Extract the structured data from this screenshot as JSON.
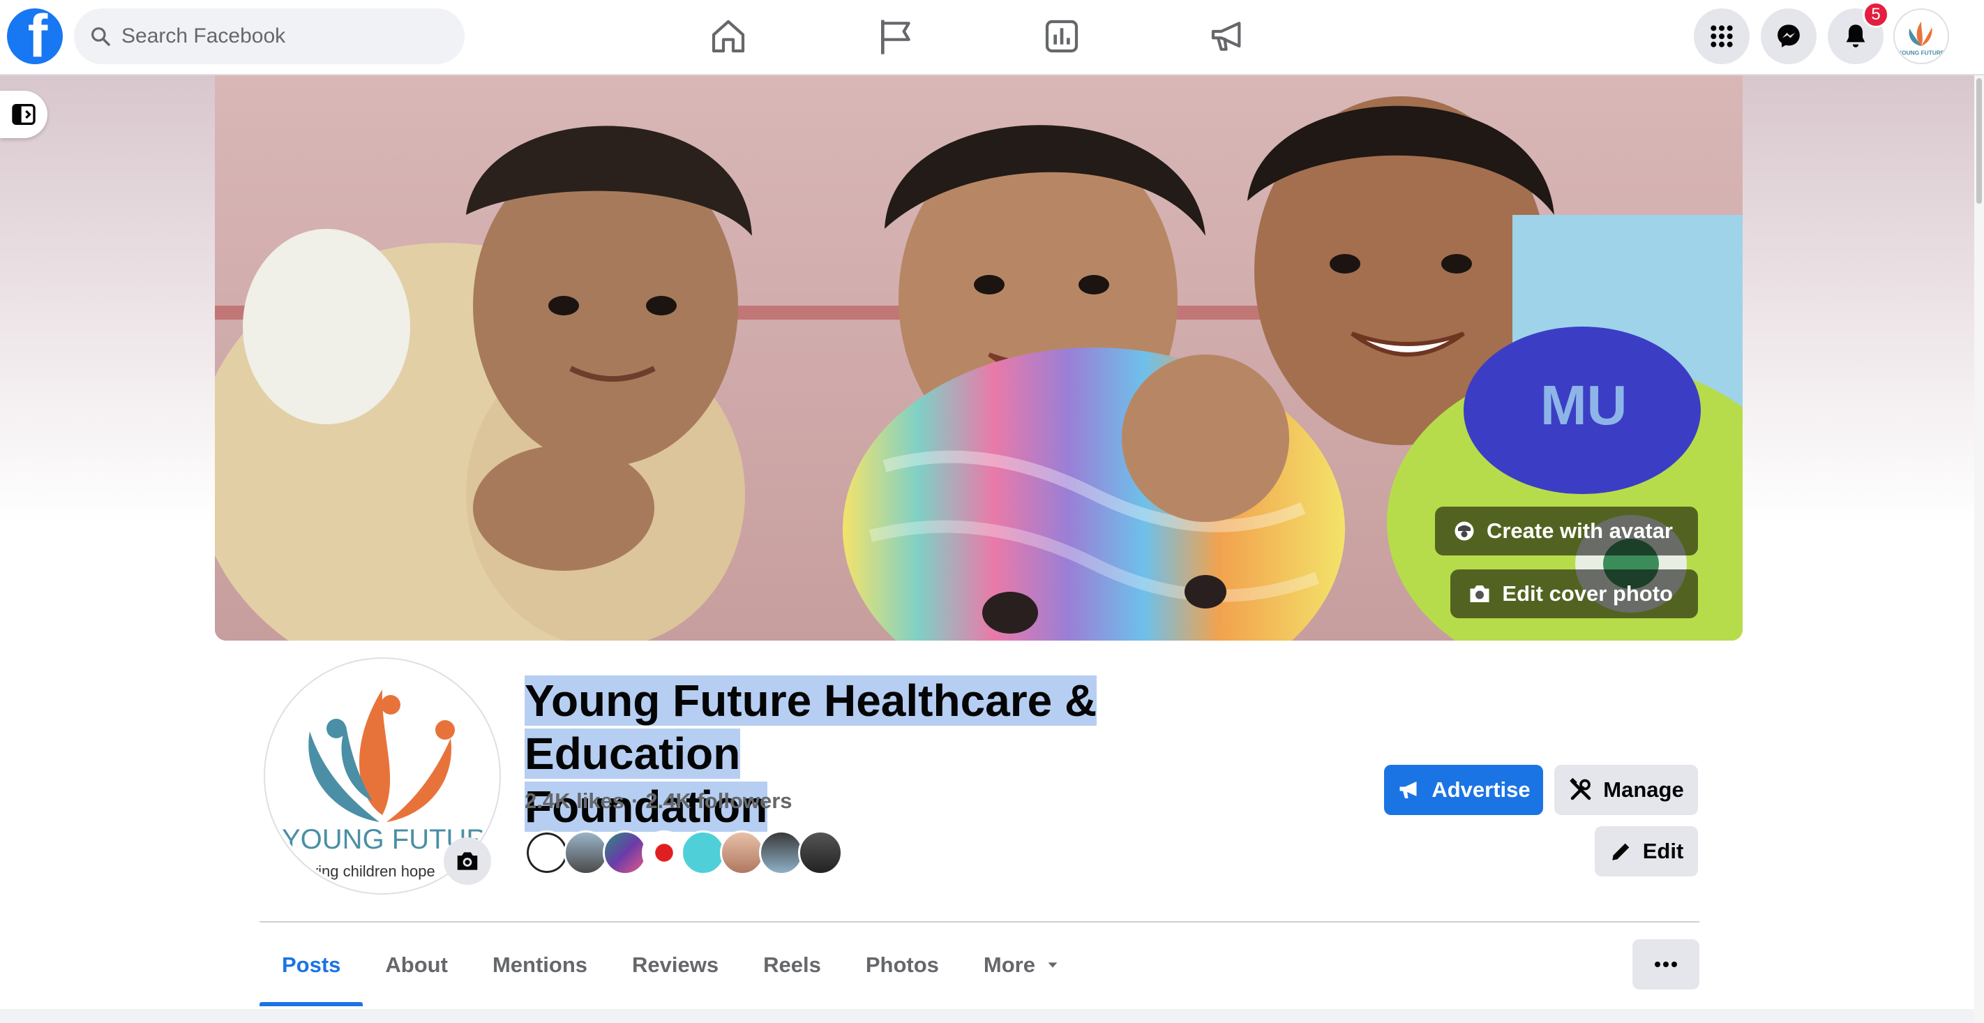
{
  "nav": {
    "search_placeholder": "Search Facebook",
    "notifications_count": "5",
    "icons": [
      "home-icon",
      "pages-flag-icon",
      "insights-icon",
      "ads-megaphone-icon"
    ]
  },
  "cover": {
    "create_avatar_label": "Create with avatar",
    "edit_cover_label": "Edit cover photo"
  },
  "profile": {
    "name_line1": "Young Future Healthcare & Education",
    "name_line2": "Foundation",
    "likes": "2.4K likes",
    "followers": "2.4K followers",
    "logo_text": "YOUNG FUTURE",
    "logo_tagline": "giving children hope"
  },
  "actions": {
    "advertise_label": "Advertise",
    "manage_label": "Manage",
    "edit_label": "Edit"
  },
  "tabs": [
    {
      "label": "Posts",
      "active": true
    },
    {
      "label": "About"
    },
    {
      "label": "Mentions"
    },
    {
      "label": "Reviews"
    },
    {
      "label": "Reels"
    },
    {
      "label": "Photos"
    },
    {
      "label": "More"
    }
  ],
  "colors": {
    "brand_blue": "#1877f2",
    "accent_blue": "#1b74e4",
    "logo_orange": "#e8733a",
    "logo_teal": "#4a8fa5",
    "badge_red": "#e41e3f"
  }
}
